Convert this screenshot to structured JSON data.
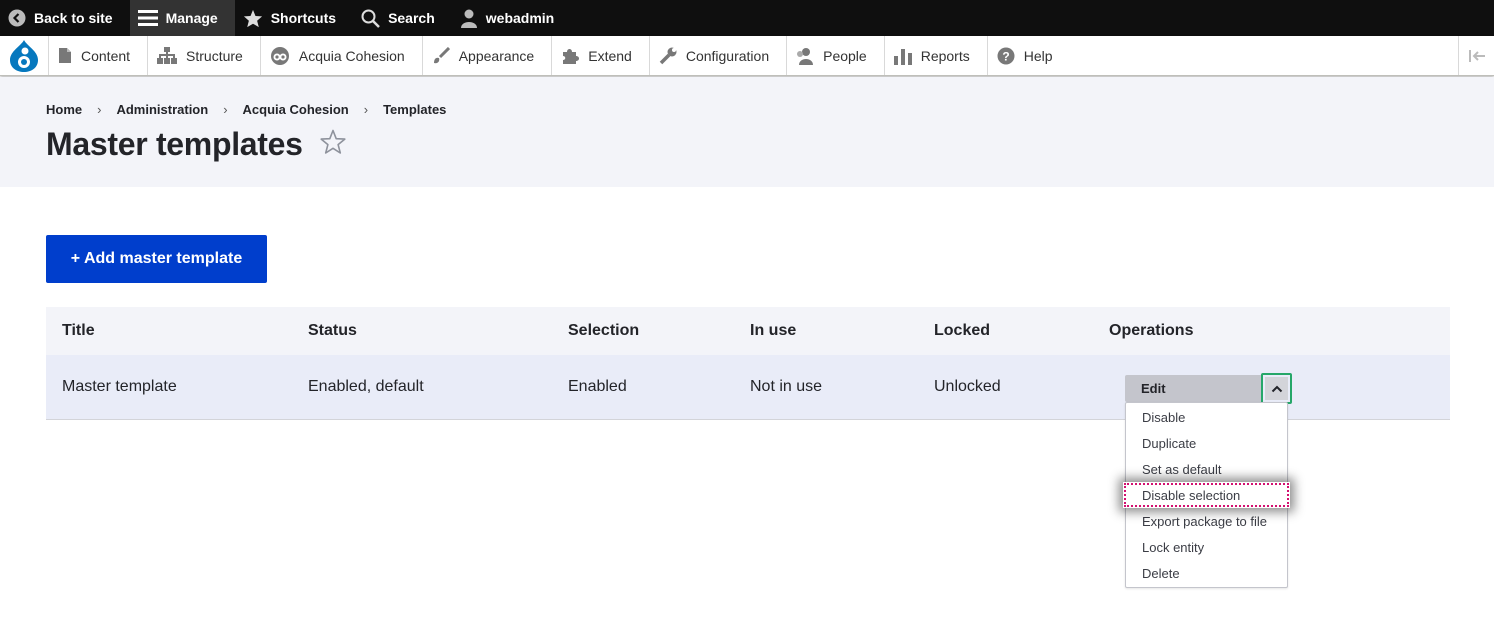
{
  "toolbar": {
    "back_to_site": "Back to site",
    "manage": "Manage",
    "shortcuts": "Shortcuts",
    "search": "Search",
    "user": "webadmin"
  },
  "tray": {
    "items": [
      "Content",
      "Structure",
      "Acquia Cohesion",
      "Appearance",
      "Extend",
      "Configuration",
      "People",
      "Reports",
      "Help"
    ]
  },
  "breadcrumb": [
    "Home",
    "Administration",
    "Acquia Cohesion",
    "Templates"
  ],
  "breadcrumb_separator": "›",
  "page": {
    "title": "Master templates",
    "add_button": "+ Add master template"
  },
  "table": {
    "headers": [
      "Title",
      "Status",
      "Selection",
      "In use",
      "Locked",
      "Operations"
    ],
    "rows": [
      {
        "title": "Master template",
        "status": "Enabled, default",
        "selection": "Enabled",
        "in_use": "Not in use",
        "locked": "Unlocked"
      }
    ]
  },
  "operations": {
    "primary": "Edit",
    "menu": [
      "Disable",
      "Duplicate",
      "Set as default",
      "Disable selection",
      "Export package to file",
      "Lock entity",
      "Delete"
    ],
    "focused_item": "Disable selection"
  },
  "colors": {
    "toolbar_bg": "#0f0f0f",
    "primary_button": "#003ecc",
    "focus_ring": "#26a769",
    "focused_outline": "#d3106f",
    "drupal_blue": "#0678be"
  }
}
